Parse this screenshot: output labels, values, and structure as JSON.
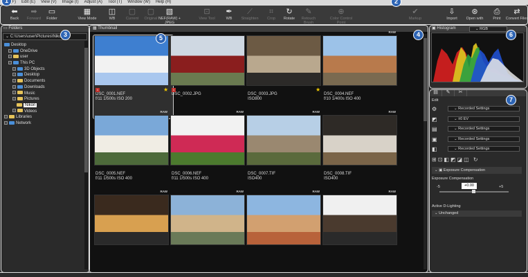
{
  "menubar": {
    "items": [
      "File (F)",
      "Edit (E)",
      "View (V)",
      "Image (I)",
      "Adjust (A)",
      "Tool (T)",
      "Window (W)",
      "Help (H)"
    ]
  },
  "toolbar": {
    "buttons": [
      {
        "label": "Back",
        "icon": "left-arrow-icon",
        "enabled": true
      },
      {
        "label": "Forward",
        "icon": "right-arrow-icon",
        "enabled": false
      },
      {
        "label": "Folder",
        "icon": "folder-icon",
        "enabled": true
      },
      {
        "label": "View Mode",
        "icon": "grid-icon",
        "enabled": true
      },
      {
        "label": "WB",
        "icon": "wb-icon",
        "enabled": true
      },
      {
        "label": "Current",
        "icon": "current-icon",
        "enabled": false
      },
      {
        "label": "Original",
        "icon": "original-icon",
        "enabled": false
      },
      {
        "label": "NEF(RAW) + JPEG",
        "icon": "nef-jpeg-icon",
        "enabled": true
      },
      {
        "label": "View Tool",
        "icon": "view-tool-icon",
        "enabled": false
      },
      {
        "label": "WB",
        "icon": "eyedropper-icon",
        "enabled": true
      },
      {
        "label": "Straighten",
        "icon": "straighten-icon",
        "enabled": false
      },
      {
        "label": "Crop",
        "icon": "crop-icon",
        "enabled": false
      },
      {
        "label": "Rotate",
        "icon": "rotate-icon",
        "enabled": true
      },
      {
        "label": "Retouch Brush",
        "icon": "brush-icon",
        "enabled": false
      },
      {
        "label": "Color Control Point",
        "icon": "color-point-icon",
        "enabled": false
      },
      {
        "label": "Markup",
        "icon": "check-icon",
        "enabled": false
      },
      {
        "label": "Import",
        "icon": "import-icon",
        "enabled": true
      },
      {
        "label": "Open with",
        "icon": "open-with-icon",
        "enabled": true
      },
      {
        "label": "Print",
        "icon": "print-icon",
        "enabled": true
      },
      {
        "label": "Convert Files",
        "icon": "convert-icon",
        "enabled": true
      }
    ]
  },
  "badges": [
    "1",
    "2",
    "3",
    "4",
    "5",
    "6",
    "7"
  ],
  "folders": {
    "title": "Folders",
    "path": "C:\\Users\\user\\Pictures\\Nikon",
    "tree": [
      {
        "label": "Desktop",
        "indent": 0,
        "plus": false,
        "blue": true
      },
      {
        "label": "OneDrive",
        "indent": 1,
        "plus": true,
        "blue": true
      },
      {
        "label": "user",
        "indent": 1,
        "plus": true,
        "blue": false
      },
      {
        "label": "This PC",
        "indent": 1,
        "plus": true,
        "blue": true
      },
      {
        "label": "3D Objects",
        "indent": 2,
        "plus": true,
        "blue": true
      },
      {
        "label": "Desktop",
        "indent": 2,
        "plus": true,
        "blue": true
      },
      {
        "label": "Documents",
        "indent": 2,
        "plus": true,
        "blue": false
      },
      {
        "label": "Downloads",
        "indent": 2,
        "plus": true,
        "blue": true
      },
      {
        "label": "Music",
        "indent": 2,
        "plus": true,
        "blue": false
      },
      {
        "label": "Pictures",
        "indent": 2,
        "plus": true,
        "blue": false
      },
      {
        "label": "Nikon",
        "indent": 3,
        "plus": false,
        "blue": false,
        "selected": true
      },
      {
        "label": "Videos",
        "indent": 2,
        "plus": true,
        "blue": false
      },
      {
        "label": "Libraries",
        "indent": 0,
        "plus": true,
        "blue": false
      },
      {
        "label": "Network",
        "indent": 0,
        "plus": true,
        "blue": true
      }
    ]
  },
  "thumbnails": {
    "title": "Thumbnail",
    "items": [
      {
        "name": "DSC_0001.NEF",
        "info": "f/11 1/500s ISO 200",
        "raw": false,
        "star": true,
        "flag": "1"
      },
      {
        "name": "DSC_0002.JPG",
        "info": "",
        "raw": false,
        "star": false,
        "flag": "1"
      },
      {
        "name": "DSC_0003.JPG",
        "info": "ISO800",
        "raw": false,
        "star": true,
        "flag": ""
      },
      {
        "name": "DSC_0004.NEF",
        "info": "f/10 1/400s ISO 400",
        "raw": true,
        "star": false,
        "flag": ""
      },
      {
        "name": "DSC_0005.NEF",
        "info": "f/11 1/500s ISO 400",
        "raw": true,
        "star": false,
        "flag": ""
      },
      {
        "name": "DSC_0006.NEF",
        "info": "f/11 1/500s ISO 400",
        "raw": true,
        "star": false,
        "flag": ""
      },
      {
        "name": "DSC_0007.TIF",
        "info": "ISO400",
        "raw": true,
        "star": false,
        "flag": ""
      },
      {
        "name": "DSC_0008.TIF",
        "info": "ISO400",
        "raw": true,
        "star": false,
        "flag": ""
      },
      {
        "name": "",
        "info": "",
        "raw": true,
        "star": false,
        "flag": ""
      },
      {
        "name": "",
        "info": "",
        "raw": true,
        "star": false,
        "flag": ""
      },
      {
        "name": "",
        "info": "",
        "raw": true,
        "star": false,
        "flag": ""
      },
      {
        "name": "",
        "info": "",
        "raw": true,
        "star": false,
        "flag": ""
      }
    ]
  },
  "histogram": {
    "title": "Histogram",
    "channel": "RGB"
  },
  "edit": {
    "title": "Edit",
    "rows": [
      {
        "icon": "gear-icon",
        "value": "Recorded Settings"
      },
      {
        "icon": "exposure-icon",
        "value": "±0 EV"
      },
      {
        "icon": "wb-small-icon",
        "value": "Recorded Settings"
      },
      {
        "icon": "picture-control-icon",
        "value": "Recorded Settings"
      },
      {
        "icon": "color-space-icon",
        "value": "Recorded Settings"
      }
    ],
    "exposure_header": "Exposure Compensation",
    "exposure_label": "Exposure Compensation",
    "exposure_value": "+0.00",
    "scale_min": "-5",
    "scale_max": "+5",
    "adl_label": "Active D-Lighting",
    "adl_value": "Unchanged"
  }
}
